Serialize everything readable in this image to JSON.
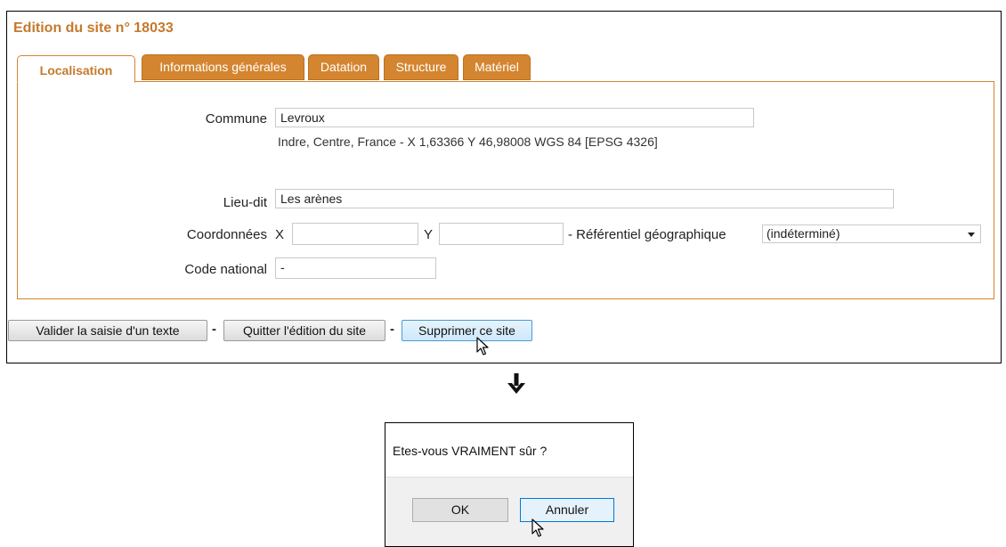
{
  "page": {
    "title": "Edition du site n° 18033"
  },
  "tabs": [
    {
      "label": "Localisation",
      "active": true
    },
    {
      "label": "Informations générales",
      "active": false
    },
    {
      "label": "Datation",
      "active": false
    },
    {
      "label": "Structure",
      "active": false
    },
    {
      "label": "Matériel",
      "active": false
    }
  ],
  "form": {
    "commune": {
      "label": "Commune",
      "value": "Levroux",
      "info": "Indre, Centre, France - X 1,63366 Y 46,98008 WGS 84 [EPSG 4326]"
    },
    "lieu_dit": {
      "label": "Lieu-dit",
      "value": "Les arènes"
    },
    "coords": {
      "label": "Coordonnées",
      "x_label": "X",
      "x_value": "",
      "y_label": "Y",
      "y_value": "",
      "ref_label": "- Référentiel géographique",
      "ref_value": "(indéterminé)"
    },
    "code_national": {
      "label": "Code national",
      "value": "-"
    }
  },
  "actions": {
    "validate": "Valider la saisie d'un texte",
    "quit": "Quitter l'édition du site",
    "delete": "Supprimer ce site",
    "separator": "-"
  },
  "dialog": {
    "message": "Etes-vous VRAIMENT sûr ?",
    "ok": "OK",
    "cancel": "Annuler"
  },
  "colors": {
    "accent": "#d4852f",
    "title": "#c47a2c",
    "button_hover": "#cde8fb"
  }
}
